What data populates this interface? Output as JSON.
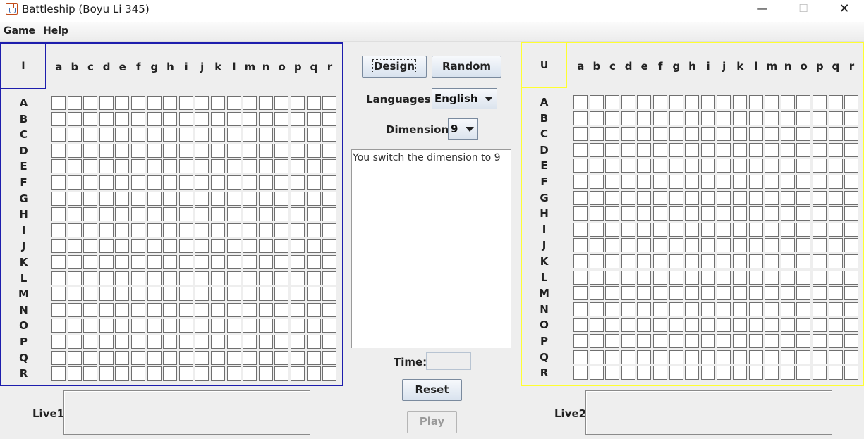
{
  "window": {
    "title": "Battleship (Boyu Li 345)",
    "minimize_glyph": "—",
    "maximize_glyph": "☐",
    "close_glyph": "✕"
  },
  "menu": {
    "game": "Game",
    "help": "Help"
  },
  "columns": [
    "a",
    "b",
    "c",
    "d",
    "e",
    "f",
    "g",
    "h",
    "i",
    "j",
    "k",
    "l",
    "m",
    "n",
    "o",
    "p",
    "q",
    "r"
  ],
  "rows": [
    "A",
    "B",
    "C",
    "D",
    "E",
    "F",
    "G",
    "H",
    "I",
    "J",
    "K",
    "L",
    "M",
    "N",
    "O",
    "P",
    "Q",
    "R"
  ],
  "left_board": {
    "corner": "I",
    "live_label": "Live1",
    "border_color": "#1d1dad"
  },
  "right_board": {
    "corner": "U",
    "live_label": "Live2",
    "border_color": "#ffff30"
  },
  "controls": {
    "design": "Design",
    "random": "Random",
    "languages_label": "Languages:",
    "language_value": "English",
    "dimension_label": "Dimension:",
    "dimension_value": "9",
    "log_text": "You switch the dimension to 9",
    "time_label": "Time:",
    "time_value": "",
    "reset": "Reset",
    "play": "Play"
  },
  "icons": {
    "app": "java-cup-icon",
    "dropdown": "chevron-down-icon"
  }
}
